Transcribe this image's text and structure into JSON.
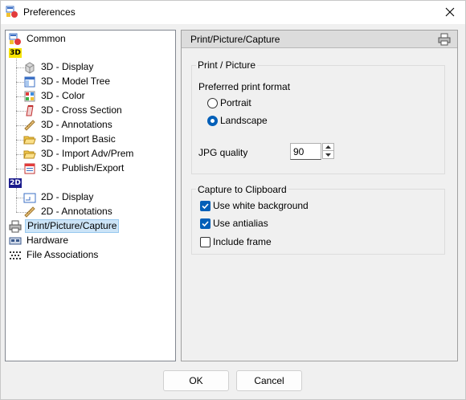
{
  "window": {
    "title": "Preferences"
  },
  "tree": {
    "items": [
      {
        "label": "Common",
        "icon": "common-icon"
      },
      {
        "label": "3D",
        "icon": "3d-badge-icon"
      },
      {
        "label": "3D - Display",
        "icon": "cube-icon"
      },
      {
        "label": "3D - Model Tree",
        "icon": "tree-window-icon"
      },
      {
        "label": "3D - Color",
        "icon": "color-palette-icon"
      },
      {
        "label": "3D - Cross Section",
        "icon": "cross-section-icon"
      },
      {
        "label": "3D - Annotations",
        "icon": "ruler-icon"
      },
      {
        "label": "3D - Import Basic",
        "icon": "folder-open-icon"
      },
      {
        "label": "3D - Import Adv/Prem",
        "icon": "folder-open-icon"
      },
      {
        "label": "3D - Publish/Export",
        "icon": "publish-icon"
      },
      {
        "label": "2D",
        "icon": "2d-badge-icon"
      },
      {
        "label": "2D - Display",
        "icon": "drawing-icon"
      },
      {
        "label": "2D - Annotations",
        "icon": "ruler-icon"
      },
      {
        "label": "Print/Picture/Capture",
        "icon": "printer-icon",
        "selected": true
      },
      {
        "label": "Hardware",
        "icon": "hardware-icon"
      },
      {
        "label": "File Associations",
        "icon": "file-association-icon"
      }
    ]
  },
  "panel": {
    "title": "Print/Picture/Capture",
    "print_group": {
      "title": "Print / Picture",
      "preferred_format_label": "Preferred print format",
      "portrait_label": "Portrait",
      "landscape_label": "Landscape",
      "selected": "Landscape",
      "jpg_quality_label": "JPG quality",
      "jpg_quality_value": "90"
    },
    "capture_group": {
      "title": "Capture to Clipboard",
      "white_bg_label": "Use white background",
      "white_bg_checked": true,
      "antialias_label": "Use antialias",
      "antialias_checked": true,
      "include_frame_label": "Include frame",
      "include_frame_checked": false
    }
  },
  "buttons": {
    "ok_label": "OK",
    "cancel_label": "Cancel"
  },
  "colors": {
    "accent": "#005fb8",
    "selection_bg": "#cce4f7",
    "header_bg": "#dcdcdc"
  }
}
